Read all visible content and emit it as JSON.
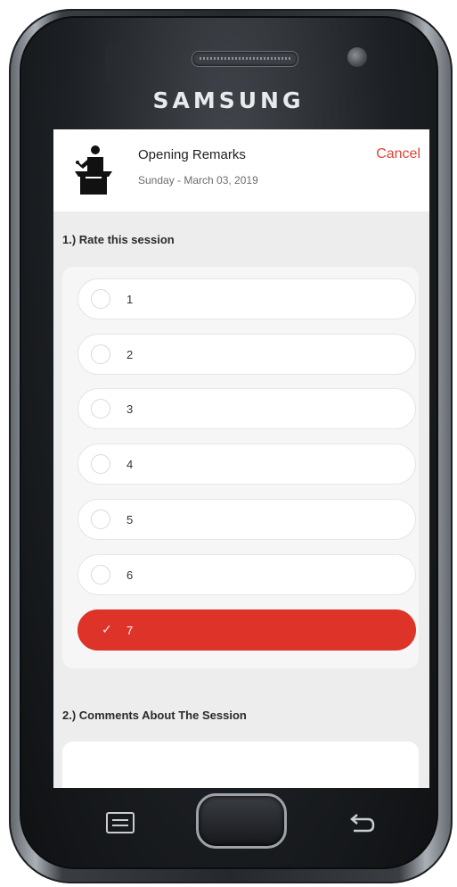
{
  "device": {
    "brand": "SAMSUNG",
    "keys": {
      "menu_icon": "menu-key-icon",
      "home_icon": "home-key",
      "back_icon": "back-arrow-icon"
    }
  },
  "header": {
    "icon": "speaker-podium-icon",
    "title": "Opening Remarks",
    "date": "Sunday - March 03, 2019",
    "cancel_label": "Cancel"
  },
  "question1": {
    "label": "1.) Rate this session",
    "options": [
      "1",
      "2",
      "3",
      "4",
      "5",
      "6",
      "7"
    ],
    "selected": "7"
  },
  "question2": {
    "label": "2.) Comments About The Session",
    "value": ""
  },
  "colors": {
    "accent": "#dd3328",
    "cancel": "#e0453a",
    "screen_bg": "#ededee"
  }
}
